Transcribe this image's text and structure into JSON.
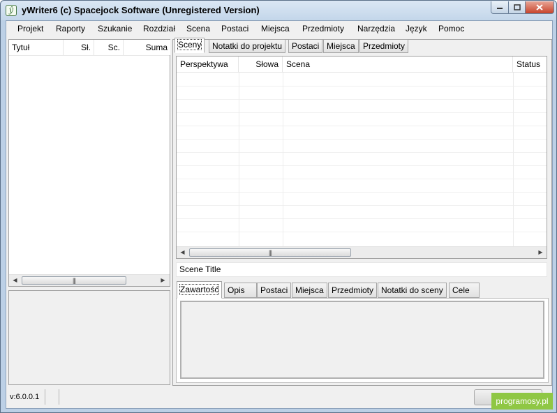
{
  "window": {
    "title": "yWriter6 (c) Spacejock Software (Unregistered Version)",
    "icon": "yw-app-icon"
  },
  "menu": [
    "Projekt",
    "Raporty",
    "Szukanie",
    "Rozdział",
    "Scena",
    "Postaci",
    "Miejsca",
    "Przedmioty",
    "Narzędzia",
    "Język",
    "Pomoc"
  ],
  "chapters_list": {
    "columns": [
      "Tytuł",
      "Sł.",
      "Sc.",
      "Suma"
    ]
  },
  "top_tabs": [
    "Sceny",
    "Notatki do projektu",
    "Postaci",
    "Miejsca",
    "Przedmioty"
  ],
  "scene_grid": {
    "columns": [
      "Perspektywa",
      "Słowa",
      "Scena",
      "Status"
    ]
  },
  "scene_title": "Scene Title",
  "bottom_tabs": [
    "Zawartość",
    "Opis",
    "Postaci",
    "Miejsca",
    "Przedmioty",
    "Notatki do sceny",
    "Cele"
  ],
  "status": {
    "version": "v:6.0.0.1"
  },
  "watermark": "programosy.pl",
  "colors": {
    "accent": "#8fc744",
    "close_button": "#c7442c",
    "titlebar": "#c3d6ea"
  }
}
